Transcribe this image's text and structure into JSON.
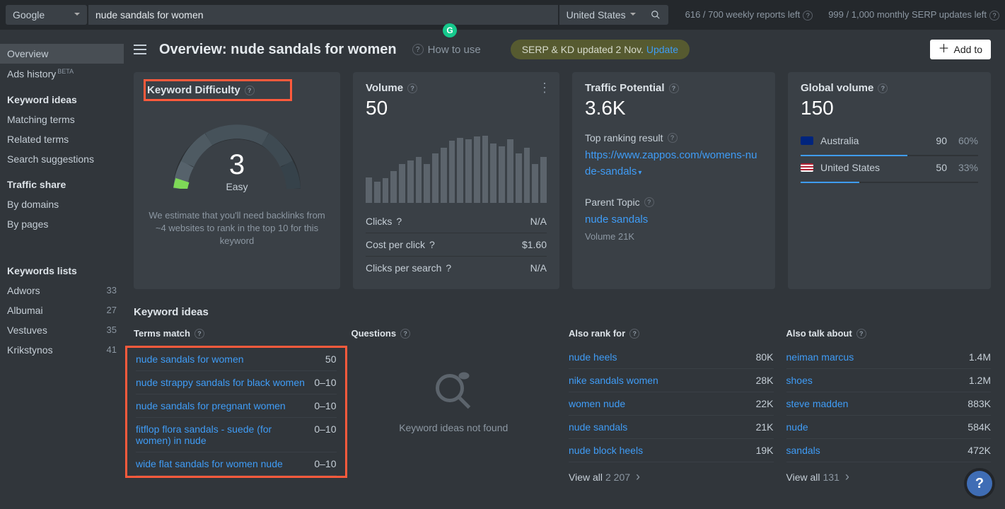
{
  "topbar": {
    "engine": "Google",
    "query": "nude sandals for women",
    "country": "United States",
    "status_reports": "616 / 700 weekly reports left",
    "status_serp": "999 / 1,000 monthly SERP updates left"
  },
  "header": {
    "title": "Overview: nude sandals for women",
    "howto": "How to use",
    "serp_text": "SERP & KD updated 2 Nov. ",
    "serp_link": "Update",
    "addto": "Add to"
  },
  "sidebar": {
    "overview": "Overview",
    "ads_history": "Ads history",
    "ads_beta": "BETA",
    "sec_ideas": "Keyword ideas",
    "matching": "Matching terms",
    "related": "Related terms",
    "suggestions": "Search suggestions",
    "sec_traffic": "Traffic share",
    "by_domains": "By domains",
    "by_pages": "By pages",
    "sec_lists": "Keywords lists",
    "lists": [
      {
        "name": "Adwors",
        "count": "33"
      },
      {
        "name": "Albumai",
        "count": "27"
      },
      {
        "name": "Vestuves",
        "count": "35"
      },
      {
        "name": "Krikstynos",
        "count": "41"
      }
    ]
  },
  "kd": {
    "title": "Keyword Difficulty",
    "score": "3",
    "label": "Easy",
    "note": "We estimate that you'll need backlinks from ~4 websites to rank in the top 10 for this keyword"
  },
  "volume": {
    "title": "Volume",
    "value": "50",
    "bars": [
      36,
      30,
      35,
      45,
      55,
      60,
      65,
      55,
      70,
      78,
      88,
      92,
      90,
      94,
      95,
      84,
      80,
      90,
      70,
      78,
      55,
      65
    ],
    "rows": [
      {
        "label": "Clicks",
        "value": "N/A"
      },
      {
        "label": "Cost per click",
        "value": "$1.60"
      },
      {
        "label": "Clicks per search",
        "value": "N/A"
      }
    ]
  },
  "tp": {
    "title": "Traffic Potential",
    "value": "3.6K",
    "rank_head": "Top ranking result",
    "rank_url": "https://www.zappos.com/womens-nude-sandals",
    "parent_head": "Parent Topic",
    "parent_kw": "nude sandals",
    "parent_vol": "Volume 21K"
  },
  "gv": {
    "title": "Global volume",
    "value": "150",
    "rows": [
      {
        "flag": "au",
        "country": "Australia",
        "val": "90",
        "pct": "60%",
        "bar": 60
      },
      {
        "flag": "us",
        "country": "United States",
        "val": "50",
        "pct": "33%",
        "bar": 33
      }
    ]
  },
  "ideas": {
    "section": "Keyword ideas",
    "terms_head": "Terms match",
    "questions_head": "Questions",
    "alsorank_head": "Also rank for",
    "alsotalk_head": "Also talk about",
    "questions_empty": "Keyword ideas not found",
    "terms": [
      {
        "kw": "nude sandals for women",
        "v": "50"
      },
      {
        "kw": "nude strappy sandals for black women",
        "v": "0–10"
      },
      {
        "kw": "nude sandals for pregnant women",
        "v": "0–10"
      },
      {
        "kw": "fitflop flora sandals - suede (for women) in nude",
        "v": "0–10"
      },
      {
        "kw": "wide flat sandals for women nude",
        "v": "0–10"
      }
    ],
    "alsorank": [
      {
        "kw": "nude heels",
        "v": "80K"
      },
      {
        "kw": "nike sandals women",
        "v": "28K"
      },
      {
        "kw": "women nude",
        "v": "22K"
      },
      {
        "kw": "nude sandals",
        "v": "21K"
      },
      {
        "kw": "nude block heels",
        "v": "19K"
      }
    ],
    "alsorank_viewall": "View all",
    "alsorank_count": "2 207",
    "alsotalk": [
      {
        "kw": "neiman marcus",
        "v": "1.4M"
      },
      {
        "kw": "shoes",
        "v": "1.2M"
      },
      {
        "kw": "steve madden",
        "v": "883K"
      },
      {
        "kw": "nude",
        "v": "584K"
      },
      {
        "kw": "sandals",
        "v": "472K"
      }
    ],
    "alsotalk_viewall": "View all",
    "alsotalk_count": "131"
  }
}
